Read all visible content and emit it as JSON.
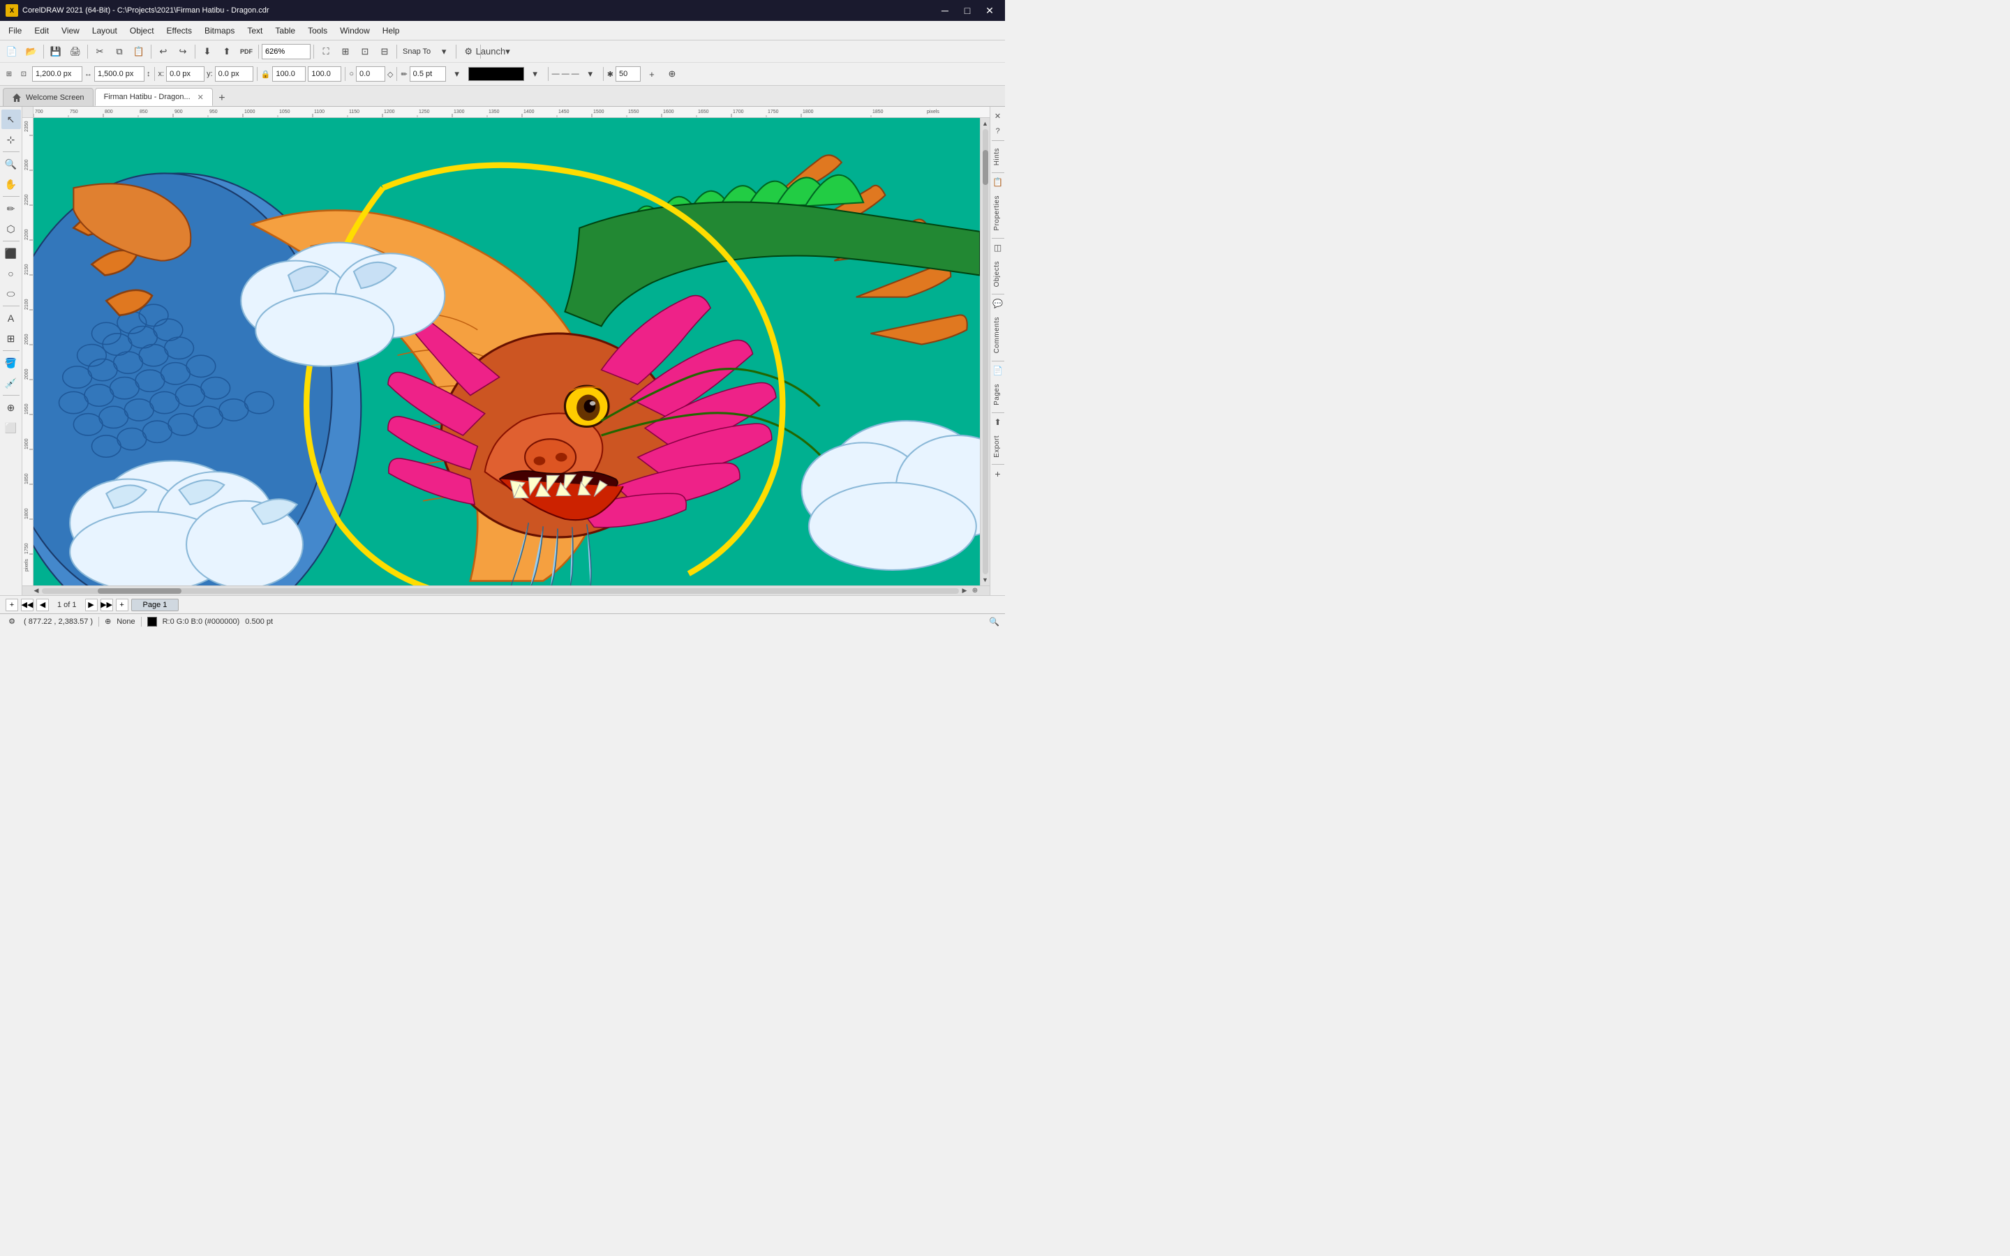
{
  "titlebar": {
    "title": "CorelDRAW 2021 (64-Bit) - C:\\Projects\\2021\\Firman Hatibu - Dragon.cdr",
    "logo": "X",
    "min_btn": "─",
    "max_btn": "□",
    "close_btn": "✕"
  },
  "menubar": {
    "items": [
      "File",
      "Edit",
      "View",
      "Layout",
      "Object",
      "Effects",
      "Bitmaps",
      "Text",
      "Table",
      "Tools",
      "Window",
      "Help"
    ]
  },
  "toolbar1": {
    "zoom_label": "626%",
    "snap_to_label": "Snap To",
    "launch_label": "Launch"
  },
  "toolbar2": {
    "width_value": "1,200.0 px",
    "height_value": "1,500.0 px",
    "x_value": "0.0 px",
    "y_value": "0.0 px",
    "w_value": "100.0",
    "h_value": "100.0",
    "stroke_value": "0.5 pt",
    "angle_value": "0.0",
    "corners_value": "50"
  },
  "tabs": {
    "items": [
      {
        "label": "Welcome Screen",
        "icon": "home",
        "active": false,
        "closeable": false
      },
      {
        "label": "Firman Hatibu - Dragon...",
        "icon": "",
        "active": true,
        "closeable": true
      }
    ],
    "add_label": "+"
  },
  "tools": {
    "items": [
      "↖",
      "⊹",
      "✦",
      "⬡",
      "⬭",
      "⬛",
      "○",
      "⊙",
      "A",
      "/",
      "✏",
      "⬜",
      "⊞",
      "⊟",
      "⊕",
      "✋"
    ]
  },
  "right_panel": {
    "items": [
      "Hints",
      "Properties",
      "Objects",
      "Comments",
      "Pages",
      "Export"
    ]
  },
  "page_controls": {
    "add_label": "+",
    "prev_first": "◀◀",
    "prev": "◀",
    "page_info": "1 of 1",
    "next": "▶",
    "next_last": "▶▶",
    "add_page": "+",
    "page_name": "Page 1"
  },
  "statusbar": {
    "coordinates": "( 877.22 , 2,383.57 )",
    "fill_none": "None",
    "color_info": "R:0 G:0 B:0 (#000000)",
    "stroke_info": "0.500 pt",
    "snap_icon": "⊕"
  }
}
